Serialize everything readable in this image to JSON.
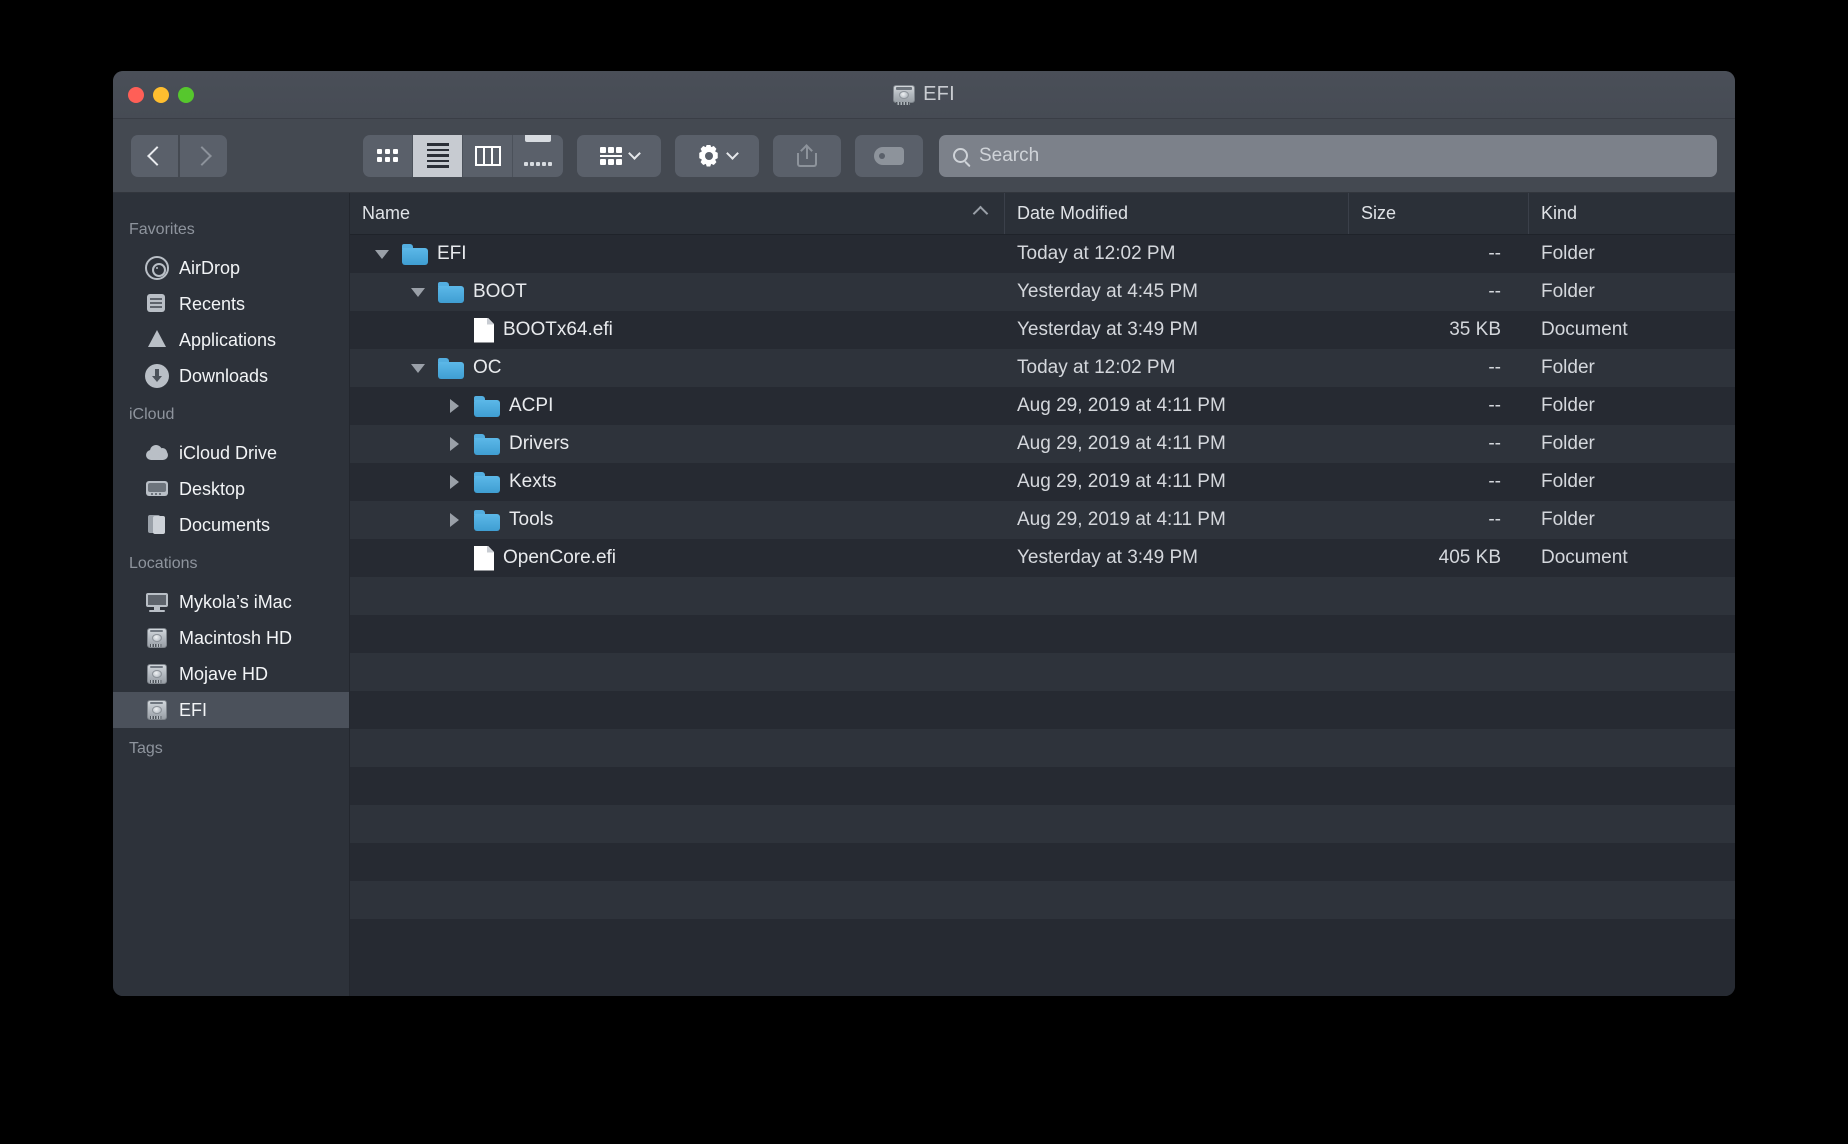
{
  "window": {
    "title": "EFI",
    "title_icon": "hard-drive-icon",
    "traffic_lights": [
      {
        "name": "close",
        "color": "#ff5f57"
      },
      {
        "name": "minimize",
        "color": "#ffbe2f"
      },
      {
        "name": "zoom",
        "color": "#56c72d"
      }
    ]
  },
  "toolbar": {
    "back_label": "",
    "forward_label": "",
    "view_modes": [
      {
        "name": "icon-view",
        "active": false
      },
      {
        "name": "list-view",
        "active": true
      },
      {
        "name": "column-view",
        "active": false
      },
      {
        "name": "gallery-view",
        "active": false
      }
    ],
    "arrange_label": "",
    "action_label": "",
    "share_label": "",
    "tags_label": "",
    "search": {
      "value": "",
      "placeholder": "Search"
    }
  },
  "sidebar": {
    "groups": [
      {
        "title": "Favorites",
        "items": [
          {
            "label": "AirDrop",
            "icon": "airdrop-icon",
            "selected": false
          },
          {
            "label": "Recents",
            "icon": "recents-icon",
            "selected": false
          },
          {
            "label": "Applications",
            "icon": "applications-icon",
            "selected": false
          },
          {
            "label": "Downloads",
            "icon": "downloads-icon",
            "selected": false
          }
        ]
      },
      {
        "title": "iCloud",
        "items": [
          {
            "label": "iCloud Drive",
            "icon": "cloud-icon",
            "selected": false
          },
          {
            "label": "Desktop",
            "icon": "desktop-icon",
            "selected": false
          },
          {
            "label": "Documents",
            "icon": "documents-icon",
            "selected": false
          }
        ]
      },
      {
        "title": "Locations",
        "items": [
          {
            "label": "Mykola’s iMac",
            "icon": "imac-icon",
            "selected": false
          },
          {
            "label": "Macintosh HD",
            "icon": "drive-icon",
            "selected": false
          },
          {
            "label": "Mojave HD",
            "icon": "drive-icon",
            "selected": false
          },
          {
            "label": "EFI",
            "icon": "drive-icon",
            "selected": true
          }
        ]
      },
      {
        "title": "Tags",
        "items": []
      }
    ]
  },
  "filelist": {
    "columns": [
      {
        "label": "Name",
        "sorted": true,
        "sort_direction": "asc"
      },
      {
        "label": "Date Modified",
        "sorted": false
      },
      {
        "label": "Size",
        "sorted": false
      },
      {
        "label": "Kind",
        "sorted": false
      }
    ],
    "rows": [
      {
        "name": "EFI",
        "depth": 0,
        "type": "folder",
        "twisty": "down",
        "date": "Today at 12:02 PM",
        "size": "--",
        "kind": "Folder"
      },
      {
        "name": "BOOT",
        "depth": 1,
        "type": "folder",
        "twisty": "down",
        "date": "Yesterday at 4:45 PM",
        "size": "--",
        "kind": "Folder"
      },
      {
        "name": "BOOTx64.efi",
        "depth": 2,
        "type": "document",
        "twisty": "none",
        "date": "Yesterday at 3:49 PM",
        "size": "35 KB",
        "kind": "Document"
      },
      {
        "name": "OC",
        "depth": 1,
        "type": "folder",
        "twisty": "down",
        "date": "Today at 12:02 PM",
        "size": "--",
        "kind": "Folder"
      },
      {
        "name": "ACPI",
        "depth": 2,
        "type": "folder",
        "twisty": "right",
        "date": "Aug 29, 2019 at 4:11 PM",
        "size": "--",
        "kind": "Folder"
      },
      {
        "name": "Drivers",
        "depth": 2,
        "type": "folder",
        "twisty": "right",
        "date": "Aug 29, 2019 at 4:11 PM",
        "size": "--",
        "kind": "Folder"
      },
      {
        "name": "Kexts",
        "depth": 2,
        "type": "folder",
        "twisty": "right",
        "date": "Aug 29, 2019 at 4:11 PM",
        "size": "--",
        "kind": "Folder"
      },
      {
        "name": "Tools",
        "depth": 2,
        "type": "folder",
        "twisty": "right",
        "date": "Aug 29, 2019 at 4:11 PM",
        "size": "--",
        "kind": "Folder"
      },
      {
        "name": "OpenCore.efi",
        "depth": 2,
        "type": "document",
        "twisty": "none",
        "date": "Yesterday at 3:49 PM",
        "size": "405 KB",
        "kind": "Document"
      }
    ],
    "empty_row_count": 9
  },
  "colors": {
    "window_background": "#2b2f37",
    "titlebar": "#464b54",
    "toolbar": "#444951",
    "sidebar": "#2d323a",
    "sidebar_selected": "#4b515b",
    "list_row_odd": "#262a32",
    "list_row_even": "#2e333b",
    "folder_blue": "#4aa9df",
    "text_primary": "#e8eaed",
    "text_secondary": "#8e949d"
  }
}
